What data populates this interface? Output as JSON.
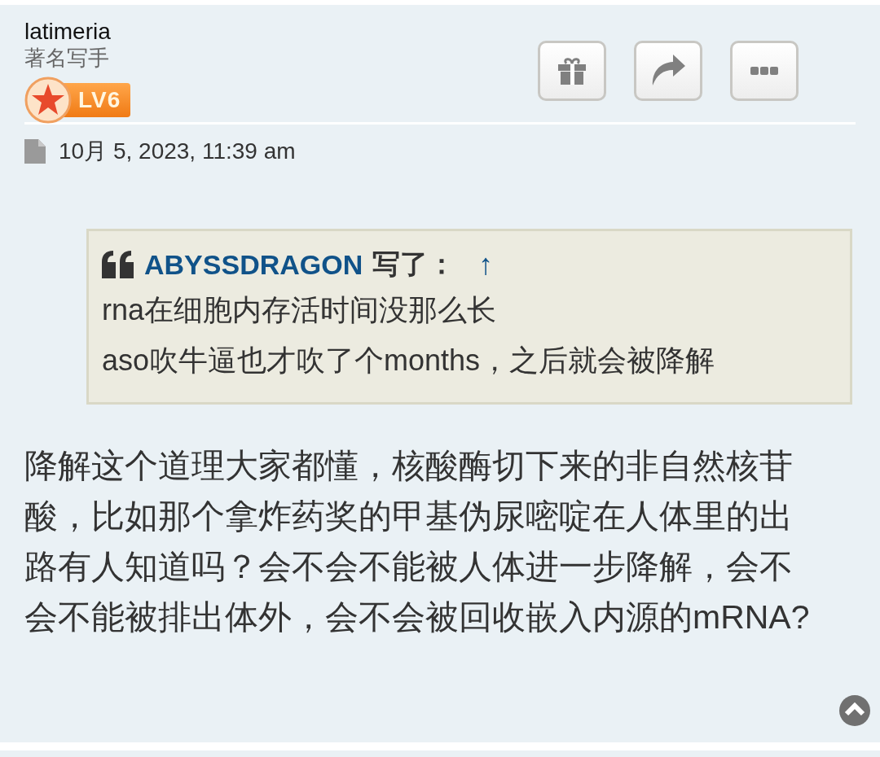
{
  "post": {
    "author": "latimeria",
    "rank": "著名写手",
    "badge": "LV6",
    "date": "10月 5, 2023, 11:39 am",
    "quote": {
      "author": "ABYSSDRAGON",
      "wrote": "写了：",
      "jump": "↑",
      "lines": [
        "rna在细胞内存活时间没那么长",
        "aso吹牛逼也才吹了个months，之后就会被降解"
      ]
    },
    "body": "降解这个道理大家都懂，核酸酶切下来的非自然核苷酸，比如那个拿炸药奖的甲基伪尿嘧啶在人体里的出路有人知道吗？会不会不能被人体进一步降解，会不会不能被排出体外，会不会被回收嵌入内源的mRNA?"
  }
}
